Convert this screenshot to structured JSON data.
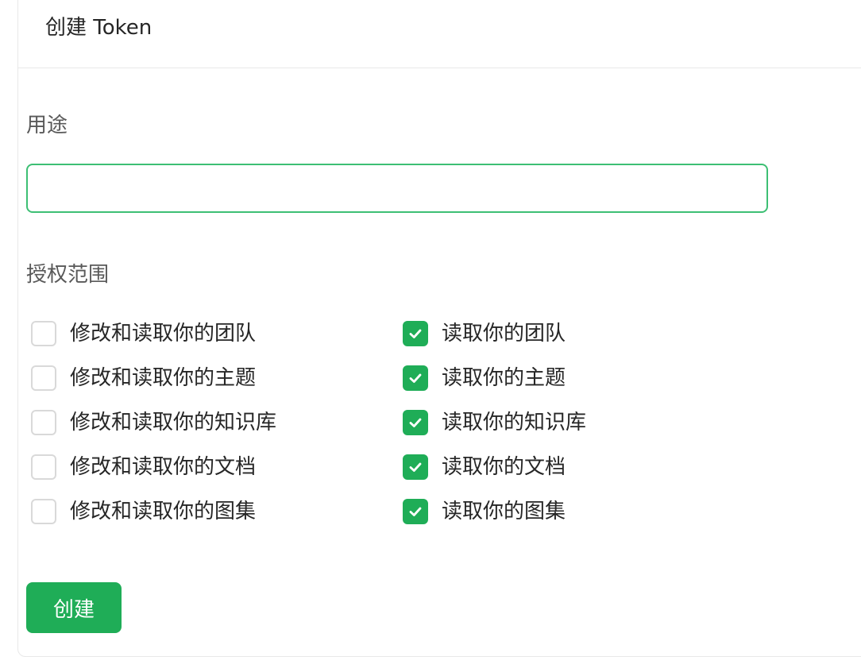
{
  "header": {
    "title": "创建 Token"
  },
  "form": {
    "purpose_label": "用途",
    "purpose_value": "",
    "purpose_placeholder": "",
    "scope_label": "授权范围",
    "scopes_left": [
      {
        "label": "修改和读取你的团队",
        "checked": false
      },
      {
        "label": "修改和读取你的主题",
        "checked": false
      },
      {
        "label": "修改和读取你的知识库",
        "checked": false
      },
      {
        "label": "修改和读取你的文档",
        "checked": false
      },
      {
        "label": "修改和读取你的图集",
        "checked": false
      }
    ],
    "scopes_right": [
      {
        "label": "读取你的团队",
        "checked": true
      },
      {
        "label": "读取你的主题",
        "checked": true
      },
      {
        "label": "读取你的知识库",
        "checked": true
      },
      {
        "label": "读取你的文档",
        "checked": true
      },
      {
        "label": "读取你的图集",
        "checked": true
      }
    ],
    "submit_label": "创建"
  },
  "colors": {
    "accent": "#1fad57",
    "input_focus_border": "#3dbf74",
    "border": "#e8e8e8"
  }
}
